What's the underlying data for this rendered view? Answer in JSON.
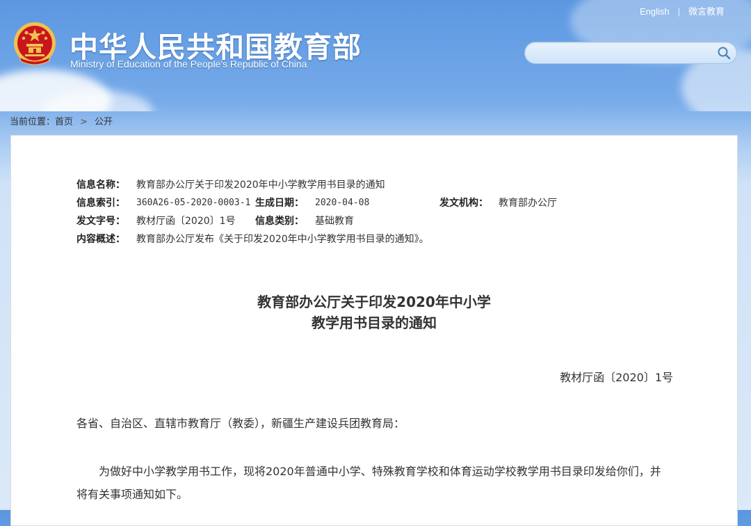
{
  "header": {
    "site_title_cn": "中华人民共和国教育部",
    "site_title_en": "Ministry of Education of the People's Republic of China",
    "links": {
      "english": "English",
      "separator": "|",
      "weibo": "微言教育"
    },
    "search": {
      "placeholder": "",
      "icon": "search-icon"
    }
  },
  "breadcrumb": {
    "prefix": "当前位置：",
    "home": "首页",
    "arrow": ">",
    "current": "公开"
  },
  "info": {
    "name_label": "信息名称：",
    "name_value": "教育部办公厅关于印发2020年中小学教学用书目录的通知",
    "index_label": "信息索引：",
    "index_value": "360A26-05-2020-0003-1",
    "date_label": "生成日期：",
    "date_value": "2020-04-08",
    "org_label": "发文机构：",
    "org_value": "教育部办公厅",
    "docno_label": "发文字号：",
    "docno_value": "教材厅函〔2020〕1号",
    "category_label": "信息类别：",
    "category_value": "基础教育",
    "summary_label": "内容概述：",
    "summary_value": "教育部办公厅发布《关于印发2020年中小学教学用书目录的通知》。"
  },
  "document": {
    "title_line1": "教育部办公厅关于印发2020年中小学",
    "title_line2": "教学用书目录的通知",
    "doc_number": "教材厅函〔2020〕1号",
    "salutation": "各省、自治区、直辖市教育厅（教委），新疆生产建设兵团教育局：",
    "paragraph1": "为做好中小学教学用书工作，现将2020年普通中小学、特殊教育学校和体育运动学校教学用书目录印发给你们，并将有关事项通知如下。"
  },
  "colors": {
    "sky_top": "#5b97e1",
    "sky_bottom": "#dbe9f8",
    "emblem_red": "#c8161d",
    "emblem_gold": "#f2c14e"
  }
}
